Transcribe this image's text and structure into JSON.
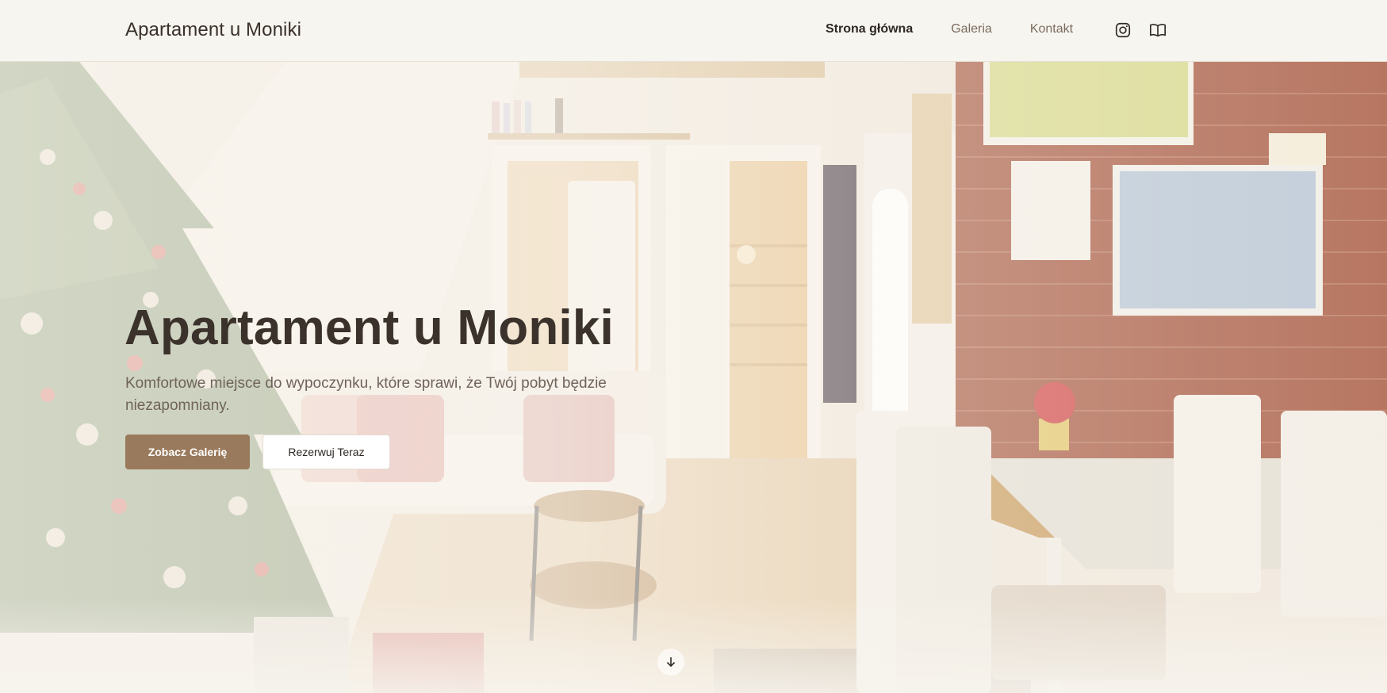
{
  "header": {
    "brand": "Apartament u Moniki",
    "nav": [
      {
        "label": "Strona główna",
        "active": true
      },
      {
        "label": "Galeria",
        "active": false
      },
      {
        "label": "Kontakt",
        "active": false
      }
    ],
    "social_icons": [
      "instagram-icon",
      "book-icon"
    ]
  },
  "hero": {
    "title": "Apartament u Moniki",
    "subtitle": "Komfortowe miejsce do wypoczynku, które sprawi, że Twój pobyt będzie niezapomniany.",
    "primary_button": "Zobacz Galerię",
    "secondary_button": "Rezerwuj Teraz",
    "scroll_icon": "arrow-down-icon"
  },
  "colors": {
    "accent": "#9a7a5c",
    "text_dark": "#3b322c",
    "text_muted": "#6f635a",
    "header_bg": "#f7f5f0"
  }
}
